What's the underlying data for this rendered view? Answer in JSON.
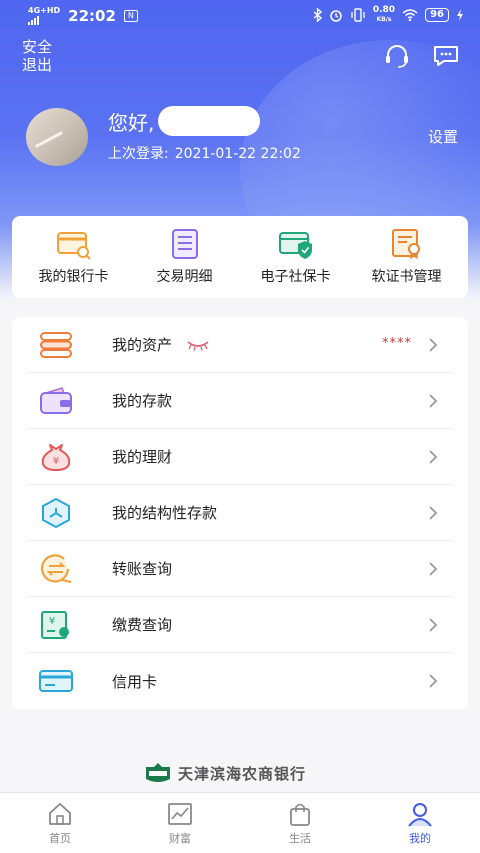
{
  "status_bar": {
    "network": "4G+HD",
    "time": "22:02",
    "notification_badge": "N",
    "speed_value": "0.80",
    "speed_unit": "KB/s",
    "battery": "96"
  },
  "header": {
    "safe_exit_line1": "安全",
    "safe_exit_line2": "退出",
    "greeting": "您好,",
    "last_login_label": "上次登录:",
    "last_login_time": "2021-01-22 22:02",
    "settings_label": "设置"
  },
  "quick_actions": [
    {
      "label": "我的银行卡",
      "icon": "bank-card-icon"
    },
    {
      "label": "交易明细",
      "icon": "transaction-list-icon"
    },
    {
      "label": "电子社保卡",
      "icon": "social-security-card-icon"
    },
    {
      "label": "软证书管理",
      "icon": "certificate-icon"
    }
  ],
  "menu": [
    {
      "label": "我的资产",
      "icon": "assets-icon",
      "masked_value": "****"
    },
    {
      "label": "我的存款",
      "icon": "wallet-icon"
    },
    {
      "label": "我的理财",
      "icon": "money-bag-icon"
    },
    {
      "label": "我的结构性存款",
      "icon": "structured-deposit-icon"
    },
    {
      "label": "转账查询",
      "icon": "transfer-icon"
    },
    {
      "label": "缴费查询",
      "icon": "bill-payment-icon"
    },
    {
      "label": "信用卡",
      "icon": "credit-card-icon"
    }
  ],
  "bank_name": "天津滨海农商银行",
  "tabs": [
    {
      "label": "首页",
      "icon": "home-icon"
    },
    {
      "label": "财富",
      "icon": "wealth-chart-icon"
    },
    {
      "label": "生活",
      "icon": "shopping-bag-icon"
    },
    {
      "label": "我的",
      "icon": "profile-icon",
      "active": true
    }
  ],
  "colors": {
    "primary": "#4f66f0",
    "active_tab": "#3f5bea",
    "orange": "#f0a23a",
    "purple": "#8a6ce8",
    "green": "#1fa67a",
    "red_mask": "#c73a3a"
  }
}
